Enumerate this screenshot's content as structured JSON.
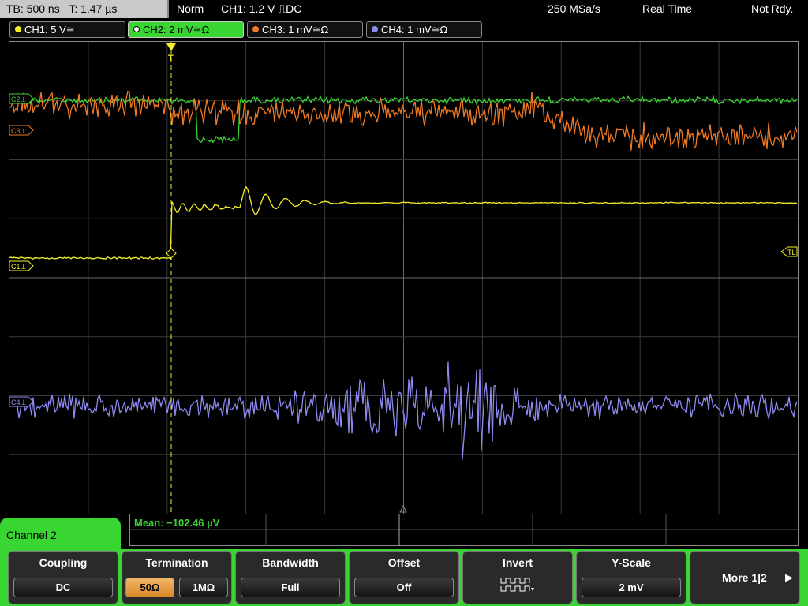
{
  "status": {
    "timebase": "TB: 500 ns",
    "trigger_time": "T: 1.47 µs",
    "mode": "Norm",
    "trigger": "CH1: 1.2 V ⎍DC",
    "sample_rate": "250 MSa/s",
    "acquisition": "Real Time",
    "state": "Not Rdy."
  },
  "channels": [
    {
      "label": "CH1: 5 V≅",
      "color": "#f5ef2a"
    },
    {
      "label": "CH2: 2 mV≅Ω",
      "color": "#39d533"
    },
    {
      "label": "CH3: 1 mV≅Ω",
      "color": "#f07a23"
    },
    {
      "label": "CH4: 1 mV≅Ω",
      "color": "#8d8af0"
    }
  ],
  "markers": {
    "c3": "C3⊥",
    "c1": "C1⊥",
    "c2": "C2⊥",
    "c4": "C4⊥",
    "trigger_level": "TL",
    "trigger_pos": "T"
  },
  "measurement": {
    "mean": "Mean: −102.46 µV"
  },
  "menu": {
    "title": "Channel 2",
    "coupling": {
      "title": "Coupling",
      "value": "DC"
    },
    "termination": {
      "title": "Termination",
      "opt1": "50Ω",
      "opt2": "1MΩ"
    },
    "bandwidth": {
      "title": "Bandwidth",
      "value": "Full"
    },
    "offset": {
      "title": "Offset",
      "value": "Off"
    },
    "invert": {
      "title": "Invert",
      "icon": "invert-waveform-icon"
    },
    "yscale": {
      "title": "Y-Scale",
      "value": "2 mV"
    },
    "more": {
      "label": "More 1|2"
    }
  }
}
